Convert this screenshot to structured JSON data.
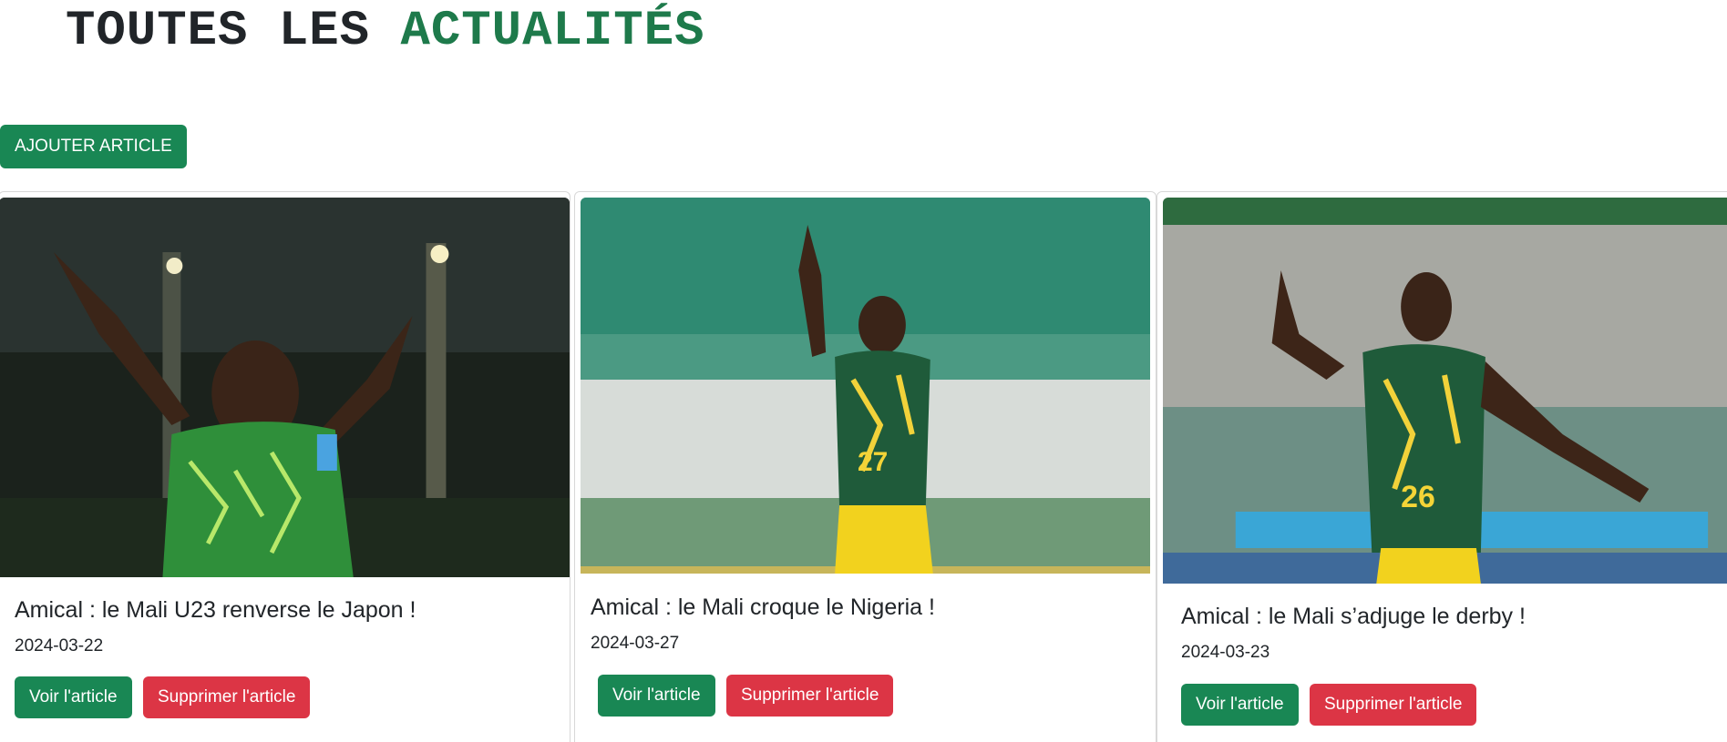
{
  "header": {
    "title_part1": "TOUTES LES",
    "title_part2": "ACTUALITÉS"
  },
  "toolbar": {
    "add_label": "AJOUTER ARTICLE"
  },
  "colors": {
    "accent": "#1e7a4b",
    "primary_button": "#198754",
    "danger_button": "#dc3545"
  },
  "articles": [
    {
      "title": "Amical : le Mali U23 renverse le Japon !",
      "date": "2024-03-22",
      "view_label": "Voir l'article",
      "delete_label": "Supprimer l'article"
    },
    {
      "title": "Amical : le Mali croque le Nigeria !",
      "date": "2024-03-27",
      "view_label": "Voir l'article",
      "delete_label": "Supprimer l'article"
    },
    {
      "title": "Amical : le Mali s’adjuge le derby !",
      "date": "2024-03-23",
      "view_label": "Voir l'article",
      "delete_label": "Supprimer l'article"
    }
  ]
}
